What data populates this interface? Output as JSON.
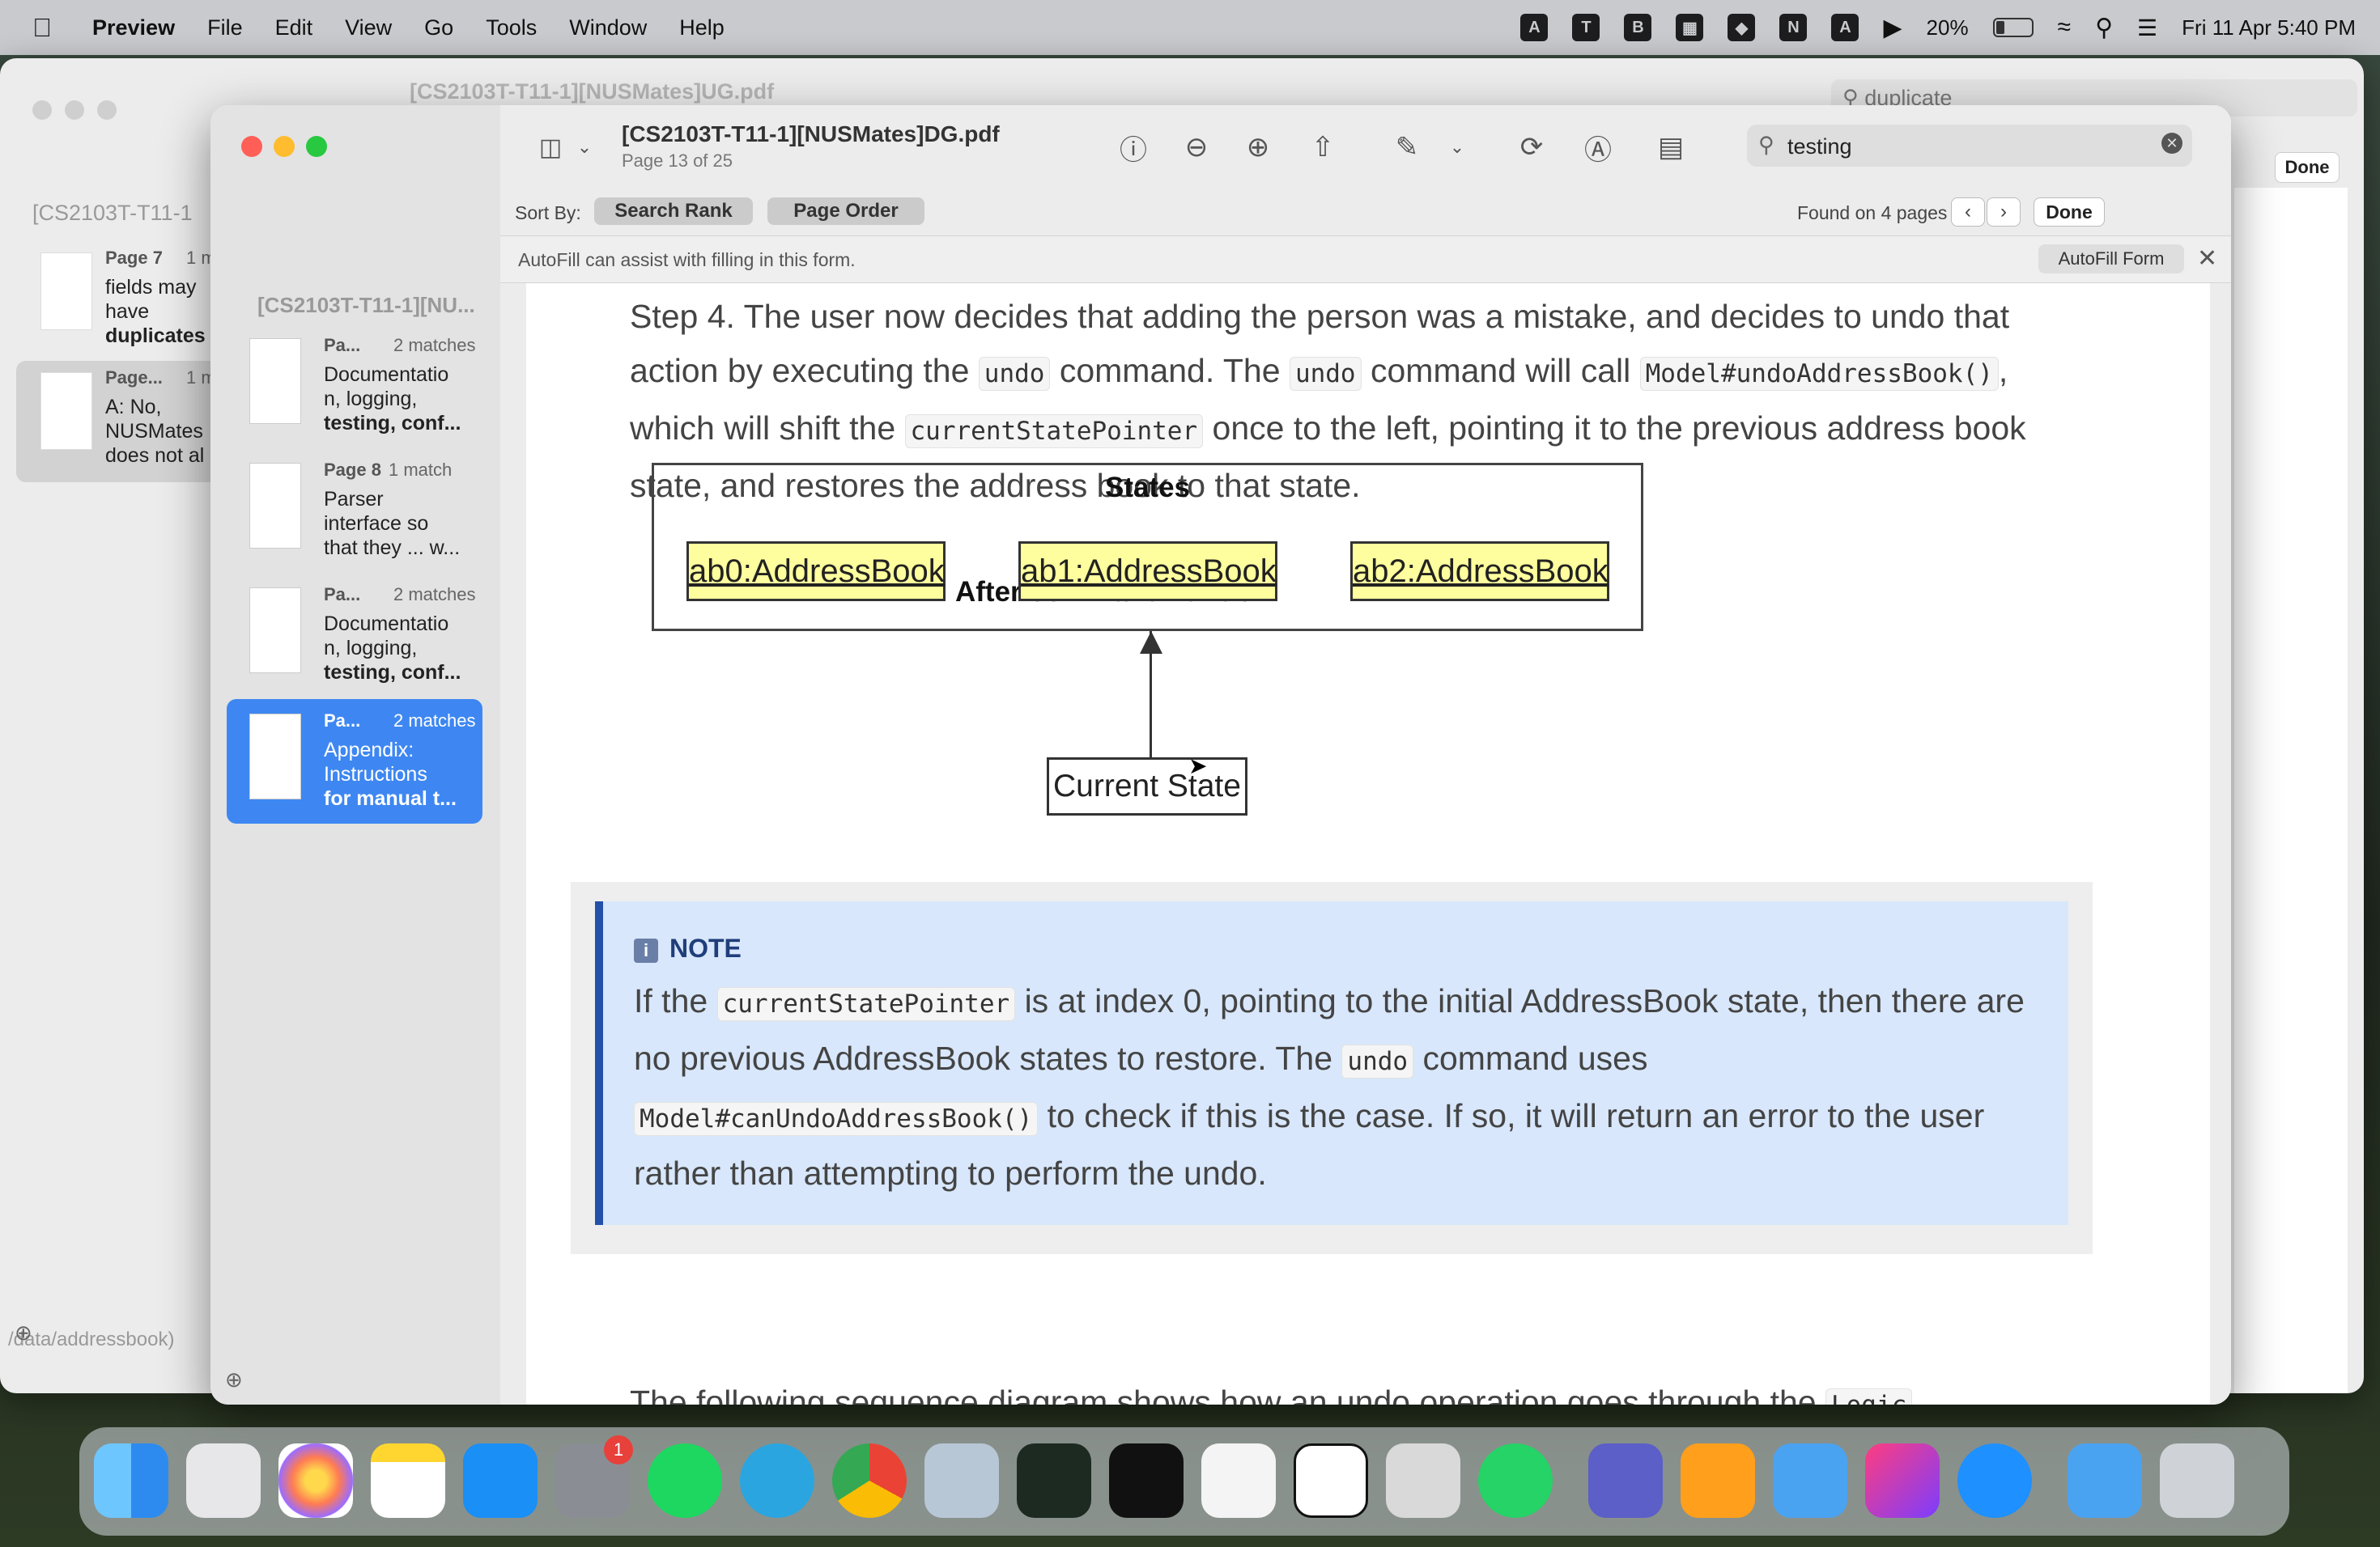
{
  "menubar": {
    "app": "Preview",
    "items": [
      "File",
      "Edit",
      "View",
      "Go",
      "Tools",
      "Window",
      "Help"
    ],
    "battery": "20%",
    "clock": "Fri 11 Apr  5:40 PM"
  },
  "bg_window": {
    "title": "[CS2103T-T11-1][NUSMates]UG.pdf",
    "search": "duplicate",
    "done": "Done",
    "sidebar_title": "[CS2103T-T11-1",
    "results": [
      {
        "page": "Page 7",
        "match": "1 m",
        "lines": [
          "fields may",
          "have",
          "duplicates"
        ]
      },
      {
        "page": "Page...",
        "match": "1 m",
        "lines": [
          "A: No,",
          "NUSMates",
          "does not al"
        ]
      }
    ],
    "bottom_text": "/data/addressbook)"
  },
  "window": {
    "doc_title": "[CS2103T-T11-1][NUSMates]DG.pdf",
    "page_of": "Page 13 of 25",
    "sidebar_title": "[CS2103T-T11-1][NU...",
    "search_value": "testing"
  },
  "results": [
    {
      "page": "Pa...",
      "match": "2 matches",
      "lines": [
        "Documentatio",
        "n, logging,",
        "testing, conf..."
      ]
    },
    {
      "page": "Page 8",
      "match": "1 match",
      "lines": [
        "Parser",
        "interface so",
        "that they ... w..."
      ]
    },
    {
      "page": "Pa...",
      "match": "2 matches",
      "lines": [
        "Documentatio",
        "n, logging,",
        "testing, conf..."
      ]
    },
    {
      "page": "Pa...",
      "match": "2 matches",
      "lines": [
        "Appendix:",
        "Instructions",
        "for manual t..."
      ]
    }
  ],
  "sortbar": {
    "label": "Sort By:",
    "rank": "Search Rank",
    "order": "Page Order",
    "found": "Found on 4 pages",
    "done": "Done"
  },
  "autofill": {
    "text": "AutoFill can assist with filling in this form.",
    "button": "AutoFill Form"
  },
  "content": {
    "step_pre": "Step 4. The user now decides that adding the person was a mistake, and decides to undo that action by executing the ",
    "undo": "undo",
    "step_mid1": " command. The ",
    "step_mid2": " command will call ",
    "model_undo": "Model#undoAddressBook()",
    "step_mid3": ", which will shift the ",
    "pointer": "currentStatePointer",
    "step_end": " once to the left, pointing it to the previous address book state, and restores the address book to that state.",
    "diagram_title": "After command \"undo\"",
    "states_label": "States",
    "ab0": "ab0:AddressBook",
    "ab1": "ab1:AddressBook",
    "ab2": "ab2:AddressBook",
    "current_state": "Current State",
    "note_label": "NOTE",
    "note_a": "If the ",
    "note_b": " is at index 0, pointing to the initial AddressBook state, then there are no previous AddressBook states to restore. The ",
    "note_c": " command uses ",
    "model_can": "Model#canUndoAddressBook()",
    "note_d": " to check if this is the case. If so, it will return an error to the user rather than attempting to perform the undo.",
    "next_line": "The following sequence diagram shows how an undo operation goes through the ",
    "logic": "Logic"
  },
  "dock": {
    "badge": "1"
  }
}
